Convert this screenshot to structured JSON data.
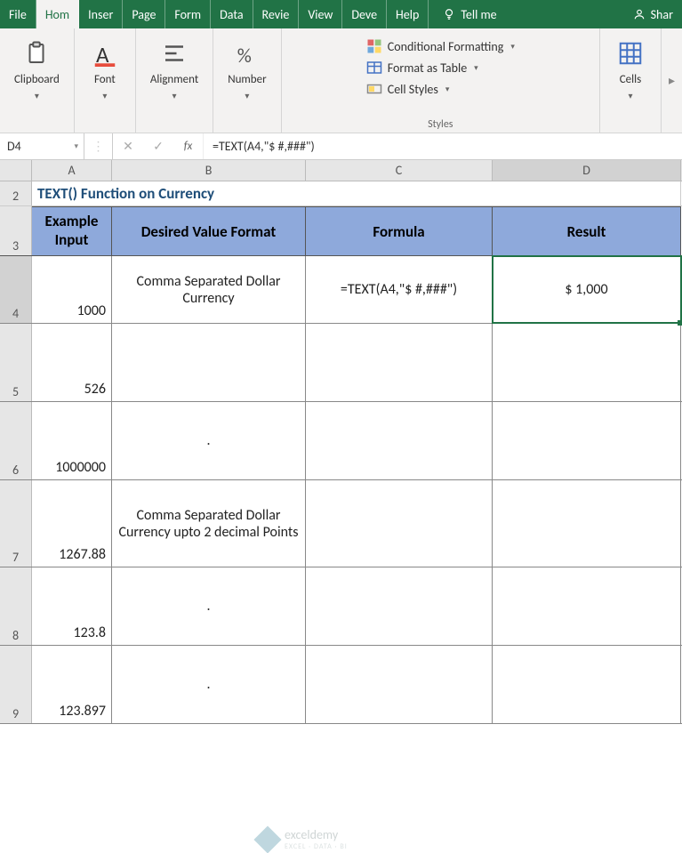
{
  "tabs": {
    "file": "File",
    "home": "Hom",
    "insert": "Inser",
    "page": "Page",
    "formulas": "Form",
    "data": "Data",
    "review": "Revie",
    "view": "View",
    "developer": "Deve",
    "help": "Help",
    "tellme": "Tell me",
    "share": "Shar"
  },
  "ribbon": {
    "clipboard": "Clipboard",
    "font": "Font",
    "alignment": "Alignment",
    "number": "Number",
    "cond_format": "Conditional Formatting",
    "format_table": "Format as Table",
    "cell_styles": "Cell Styles",
    "styles": "Styles",
    "cells": "Cells"
  },
  "namebox": "D4",
  "formula": "=TEXT(A4,\"$ #,###\")",
  "columns": {
    "a": "A",
    "b": "B",
    "c": "C",
    "d": "D"
  },
  "rows": {
    "r2": "2",
    "r3": "3",
    "r4": "4",
    "r5": "5",
    "r6": "6",
    "r7": "7",
    "r8": "8",
    "r9": "9"
  },
  "sheet": {
    "title": "TEXT() Function on Currency",
    "headers": {
      "a": "Example Input",
      "b": "Desired Value Format",
      "c": "Formula",
      "d": "Result"
    },
    "r4": {
      "a": "1000",
      "b": "Comma Separated Dollar Currency",
      "c": "=TEXT(A4,\"$ #,###\")",
      "d": "$ 1,000"
    },
    "r5": {
      "a": "526",
      "b": "",
      "c": "",
      "d": ""
    },
    "r6": {
      "a": "1000000",
      "b": ".",
      "c": "",
      "d": ""
    },
    "r7": {
      "a": "1267.88",
      "b": "Comma Separated Dollar Currency upto 2 decimal Points",
      "c": "",
      "d": ""
    },
    "r8": {
      "a": "123.8",
      "b": ".",
      "c": "",
      "d": ""
    },
    "r9": {
      "a": "123.897",
      "b": ".",
      "c": "",
      "d": ""
    }
  },
  "watermark": {
    "name": "exceldemy",
    "sub": "EXCEL · DATA · BI"
  }
}
